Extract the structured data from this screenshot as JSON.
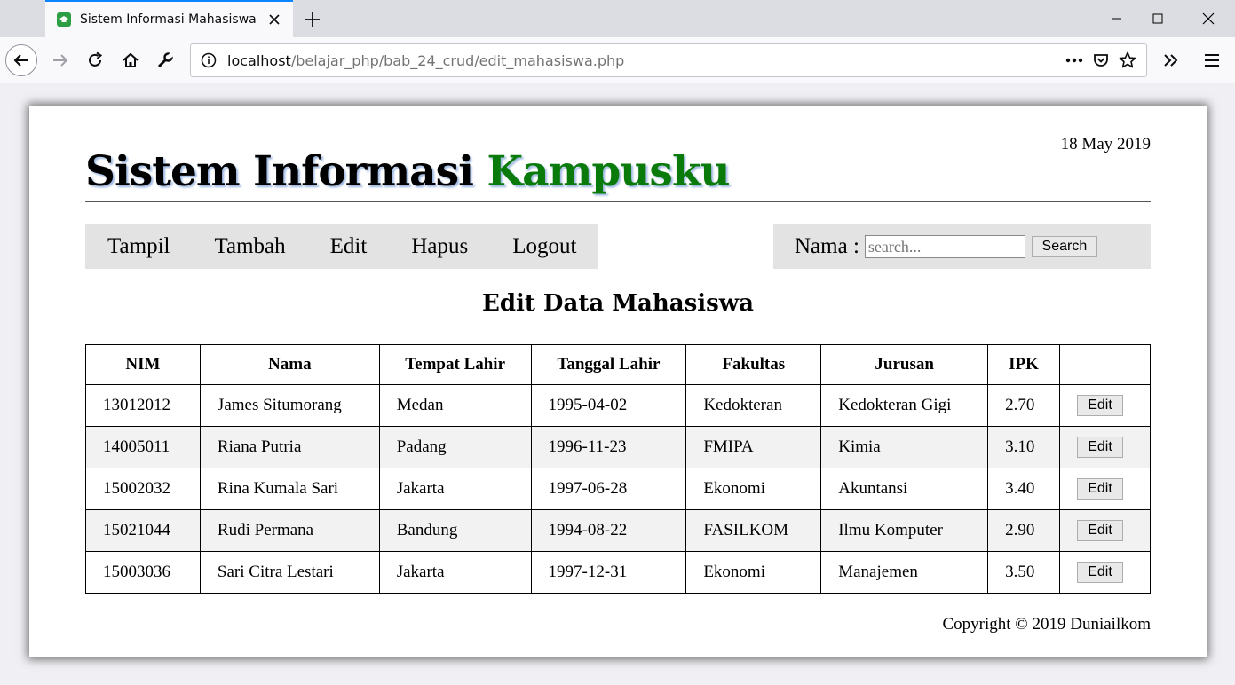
{
  "browser": {
    "tab_title": "Sistem Informasi Mahasiswa",
    "url_host": "localhost",
    "url_path": "/belajar_php/bab_24_crud/edit_mahasiswa.php"
  },
  "page": {
    "date": "18 May 2019",
    "site_title_main": "Sistem Informasi ",
    "site_title_accent": "Kampusku",
    "accent_color": "#0a7a0a",
    "menu": [
      "Tampil",
      "Tambah",
      "Edit",
      "Hapus",
      "Logout"
    ],
    "search": {
      "label": "Nama :",
      "placeholder": "search...",
      "button": "Search"
    },
    "heading": "Edit Data Mahasiswa",
    "table": {
      "headers": [
        "NIM",
        "Nama",
        "Tempat Lahir",
        "Tanggal Lahir",
        "Fakultas",
        "Jurusan",
        "IPK",
        ""
      ],
      "rows": [
        {
          "nim": "13012012",
          "nama": "James Situmorang",
          "tempat": "Medan",
          "tanggal": "1995-04-02",
          "fakultas": "Kedokteran",
          "jurusan": "Kedokteran Gigi",
          "ipk": "2.70",
          "action": "Edit"
        },
        {
          "nim": "14005011",
          "nama": "Riana Putria",
          "tempat": "Padang",
          "tanggal": "1996-11-23",
          "fakultas": "FMIPA",
          "jurusan": "Kimia",
          "ipk": "3.10",
          "action": "Edit"
        },
        {
          "nim": "15002032",
          "nama": "Rina Kumala Sari",
          "tempat": "Jakarta",
          "tanggal": "1997-06-28",
          "fakultas": "Ekonomi",
          "jurusan": "Akuntansi",
          "ipk": "3.40",
          "action": "Edit"
        },
        {
          "nim": "15021044",
          "nama": "Rudi Permana",
          "tempat": "Bandung",
          "tanggal": "1994-08-22",
          "fakultas": "FASILKOM",
          "jurusan": "Ilmu Komputer",
          "ipk": "2.90",
          "action": "Edit"
        },
        {
          "nim": "15003036",
          "nama": "Sari Citra Lestari",
          "tempat": "Jakarta",
          "tanggal": "1997-12-31",
          "fakultas": "Ekonomi",
          "jurusan": "Manajemen",
          "ipk": "3.50",
          "action": "Edit"
        }
      ]
    },
    "footer": "Copyright © 2019 Duniailkom"
  }
}
